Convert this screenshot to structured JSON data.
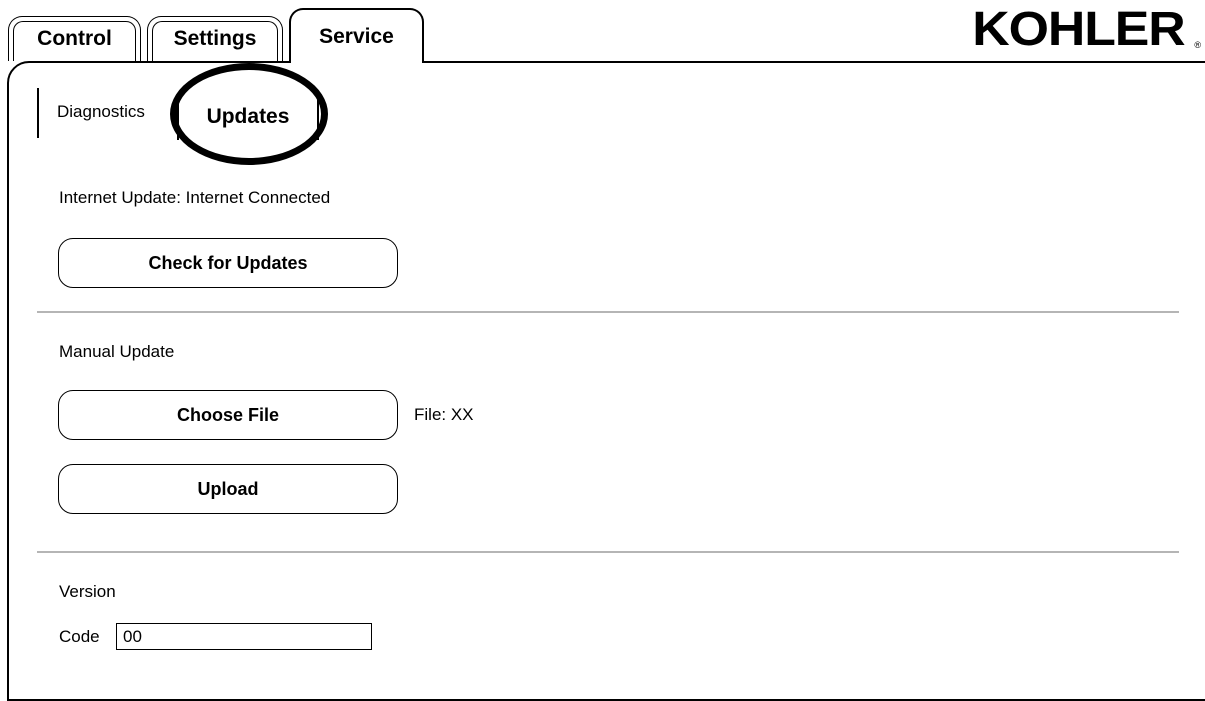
{
  "tabs": {
    "control": "Control",
    "settings": "Settings",
    "service": "Service"
  },
  "logo": {
    "text": "KOHLER",
    "mark": "®"
  },
  "subtabs": {
    "diagnostics": "Diagnostics",
    "updates": "Updates"
  },
  "internet_update": {
    "status": "Internet Update: Internet Connected",
    "check_button": "Check for Updates"
  },
  "manual_update": {
    "title": "Manual Update",
    "choose_button": "Choose File",
    "file_label": "File: XX",
    "upload_button": "Upload"
  },
  "version": {
    "title": "Version",
    "code_label": "Code",
    "code_value": "00"
  }
}
